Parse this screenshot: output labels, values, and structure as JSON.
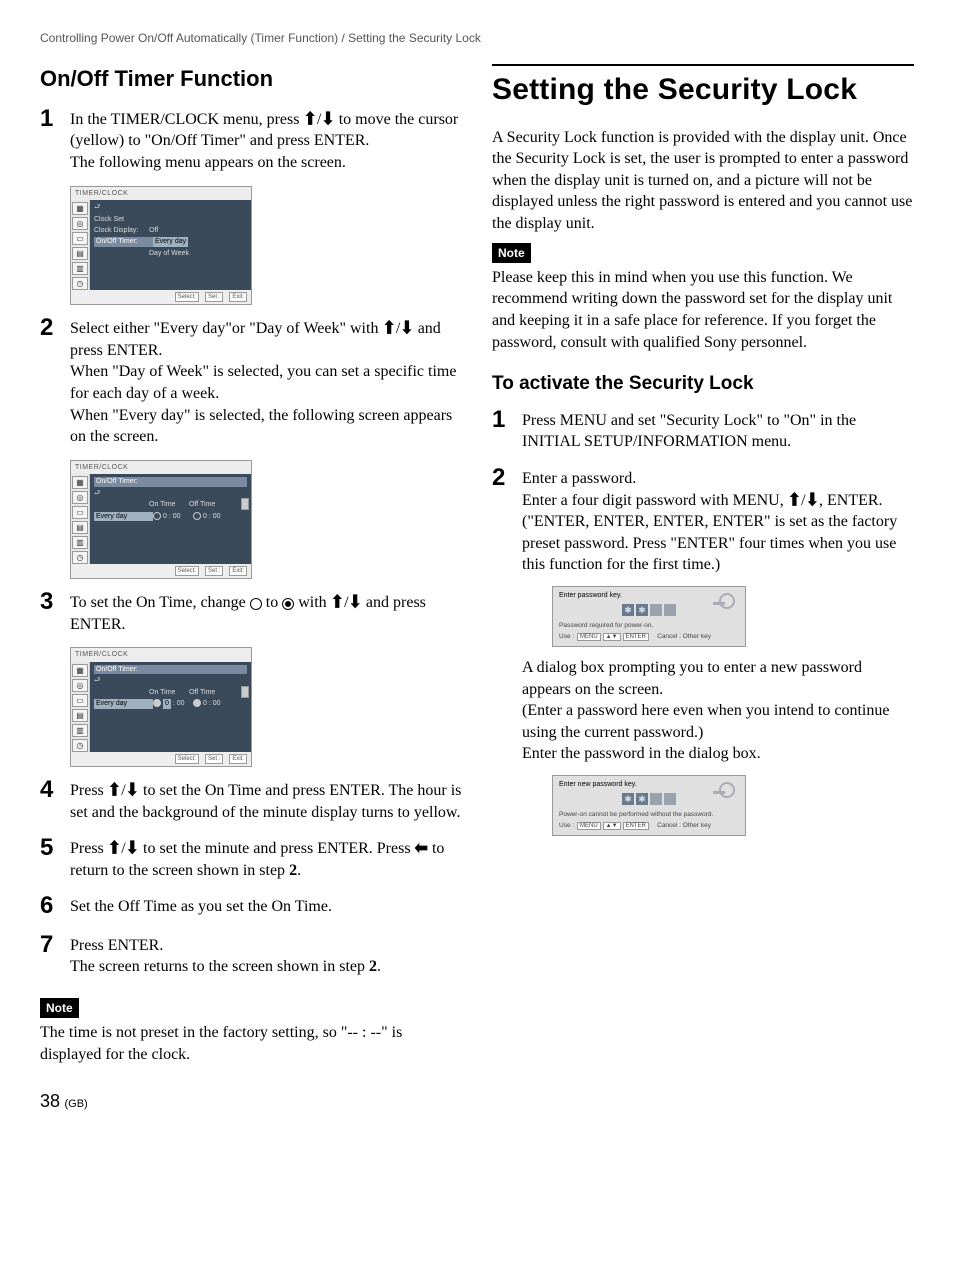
{
  "breadcrumb": "Controlling Power On/Off Automatically (Timer Function) / Setting the Security Lock",
  "left": {
    "heading": "On/Off Timer Function",
    "steps": {
      "s1a": "In the TIMER/CLOCK menu, press ",
      "s1b": " to move the cursor (yellow) to \"On/Off Timer\" and press ENTER.",
      "s1c": "The following menu appears on the screen.",
      "s2a": "Select either \"Every day\"or \"Day of Week\" with ",
      "s2b": " and press ENTER.",
      "s2c": "When \"Day of Week\" is selected, you can set a specific time for each day of a week.",
      "s2d": "When \"Every day\" is selected, the following screen appears on the screen.",
      "s3a": "To set the On Time, change ",
      "s3b": " to ",
      "s3c": " with ",
      "s3d": " and press ENTER.",
      "s4a": "Press ",
      "s4b": " to set the On Time and press ENTER. The hour is set and the background of the minute display turns to yellow.",
      "s5a": "Press ",
      "s5b": " to set the minute and press ENTER. Press ",
      "s5c": " to return to the screen shown in step ",
      "s5d": ".",
      "s6": "Set the Off Time as you set the On Time.",
      "s7a": "Press ENTER.",
      "s7b": "The screen returns to the screen shown in step ",
      "s7c": "."
    },
    "note_label": "Note",
    "note_text": "The time is not preset in the factory setting, so \"-- : --\" is displayed for the clock.",
    "menu": {
      "title": "TIMER/CLOCK",
      "clock_set": "Clock Set",
      "clock_display": "Clock Display:",
      "clock_display_val": "Off",
      "onoff_timer": "On/Off Timer:",
      "every_day": "Every day",
      "day_of_week": "Day of Week",
      "on_time": "On Time",
      "off_time": "Off Time",
      "time_zero": "0",
      "time_zerozero": "00",
      "footer_select": "Select:",
      "footer_set": "Set :",
      "footer_set_key": "ENTER",
      "footer_exit": "Exit:",
      "footer_exit_key": "MENU"
    }
  },
  "right": {
    "heading": "Setting the Security Lock",
    "intro": "A Security Lock function is provided with the display unit. Once the Security Lock is set, the user is prompted to enter a password when the display unit is turned on, and a picture will not be displayed unless the right password is entered and you cannot use the display unit.",
    "note_label": "Note",
    "note_text": "Please keep this in mind when you use this function. We recommend writing down the password set for the display unit and keeping it in a safe place for reference. If you forget the password, consult with qualified Sony personnel.",
    "sub": "To activate the Security Lock",
    "s1": "Press MENU and set \"Security Lock\" to \"On\" in the INITIAL SETUP/INFORMATION menu.",
    "s2a": "Enter a password.",
    "s2b": "Enter a four digit password with MENU, ",
    "s2c": ", ENTER.",
    "s2d": "(\"ENTER, ENTER, ENTER, ENTER\" is set as the factory preset password. Press \"ENTER\" four times when you use this function for the first time.)",
    "s2e": "A dialog box prompting you to enter a new password appears on the screen.",
    "s2f": "(Enter a password here even when you intend to continue using the current password.)",
    "s2g": "Enter the password in the dialog box.",
    "pw1": {
      "prompt": "Enter password key.",
      "msg": "Password required for power-on.",
      "use": "Use :",
      "cancel": "Cancel : Other key"
    },
    "pw2": {
      "prompt": "Enter new password key.",
      "msg": "Power-on cannot be performed without the password.",
      "use": "Use :",
      "cancel": "Cancel : Other key"
    }
  },
  "page": {
    "num": "38",
    "region": "(GB)"
  },
  "bold2": "2"
}
